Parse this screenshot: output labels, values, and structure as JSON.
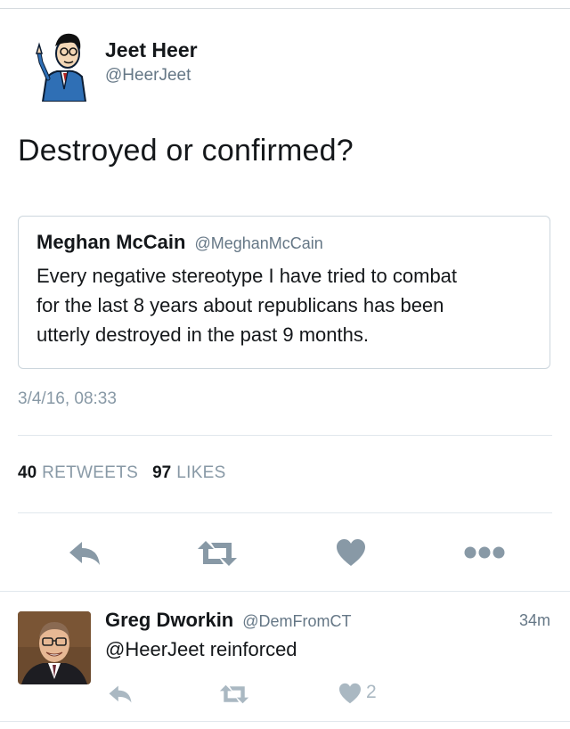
{
  "tweet": {
    "author": {
      "name": "Jeet Heer",
      "handle": "@HeerJeet"
    },
    "text": "Destroyed or confirmed?",
    "quoted": {
      "name": "Meghan McCain",
      "handle": "@MeghanMcCain",
      "lines": [
        "Every negative stereotype I have tried to combat",
        "for the last 8 years about republicans has been",
        "utterly destroyed in the past 9 months."
      ]
    },
    "timestamp": "3/4/16, 08:33",
    "stats": {
      "retweets_count": "40",
      "retweets_label": "RETWEETS",
      "likes_count": "97",
      "likes_label": "LIKES"
    },
    "actions": [
      "reply-icon",
      "retweet-icon",
      "heart-icon",
      "more-icon"
    ]
  },
  "reply": {
    "name": "Greg Dworkin",
    "handle": "@DemFromCT",
    "time": "34m",
    "text": "@HeerJeet reinforced",
    "like_count": "2",
    "actions": [
      "reply-icon",
      "retweet-icon",
      "heart-icon"
    ]
  },
  "colors": {
    "text": "#14171a",
    "secondary": "#657786",
    "icon": "#8899a6",
    "icon_light": "#aab8c2",
    "border": "#ccd6dd"
  }
}
